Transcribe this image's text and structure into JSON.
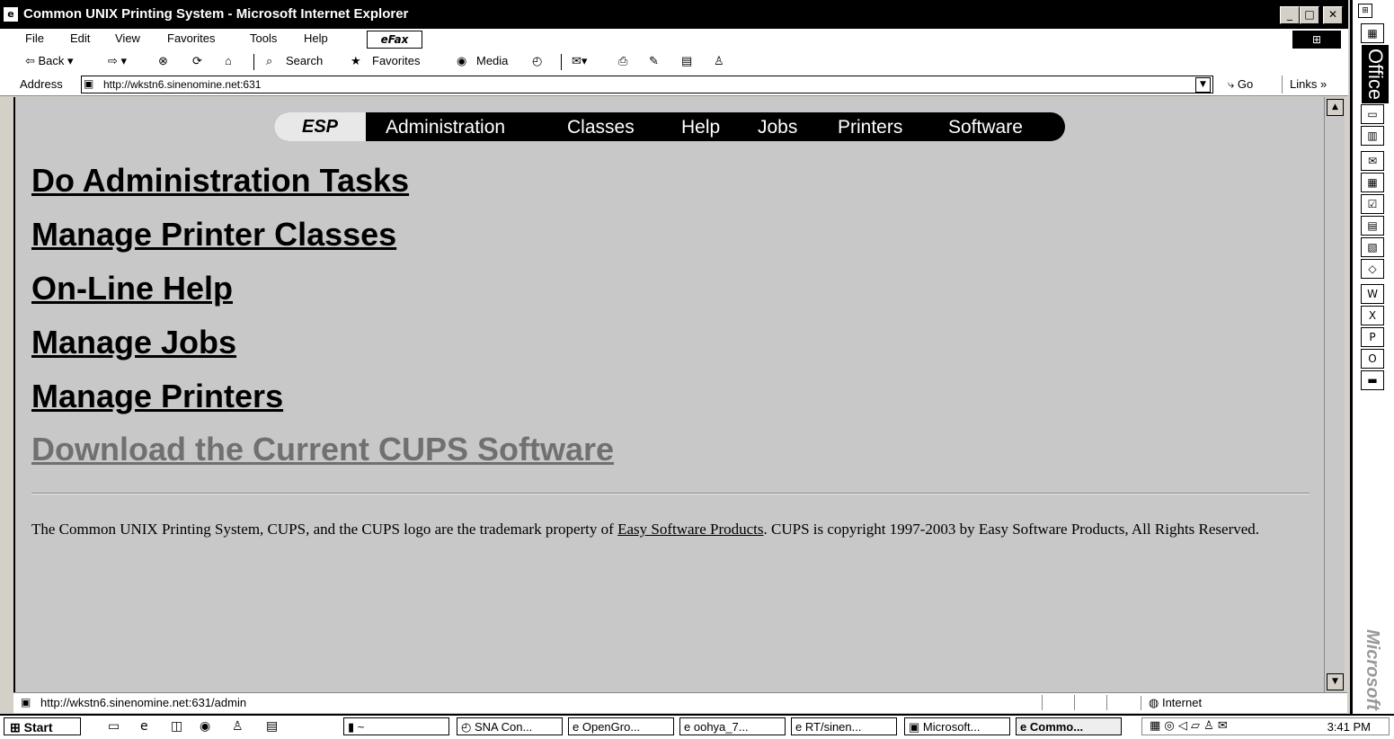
{
  "window": {
    "title": "Common UNIX Printing System - Microsoft Internet Explorer",
    "minimize": "_",
    "maximize": "□",
    "close": "✕"
  },
  "menu": [
    "File",
    "Edit",
    "View",
    "Favorites",
    "Tools",
    "Help"
  ],
  "efax_label": "eFax",
  "toolbar": {
    "back": "⇦ Back ▾",
    "forward": "⇨ ▾",
    "search": "Search",
    "favorites": "Favorites",
    "media": "Media"
  },
  "address": {
    "label": "Address",
    "url": "http://wkstn6.sinenomine.net:631",
    "go": "Go",
    "links": "Links »"
  },
  "nav": {
    "logo": "ESP",
    "items": [
      "Administration",
      "Classes",
      "Help",
      "Jobs",
      "Printers",
      "Software"
    ]
  },
  "links": [
    "Do Administration Tasks",
    "Manage Printer Classes",
    "On-Line Help",
    "Manage Jobs",
    "Manage Printers",
    "Download the Current CUPS Software"
  ],
  "footer": {
    "before": "The Common UNIX Printing System, CUPS, and the CUPS logo are the trademark property of ",
    "link": "Easy Software Products",
    "after": ". CUPS is copyright 1997-2003 by Easy Software Products, All Rights Reserved."
  },
  "status": {
    "text": "http://wkstn6.sinenomine.net:631/admin",
    "zone": "Internet"
  },
  "taskbar": {
    "start": "Start",
    "tasks": [
      "~",
      "SNA Con...",
      "OpenGro...",
      "oohya_7...",
      "RT/sinen...",
      "Microsoft...",
      "Commo..."
    ],
    "clock": "3:41 PM"
  },
  "office": {
    "label": "Office",
    "brand": "Microsoft"
  }
}
